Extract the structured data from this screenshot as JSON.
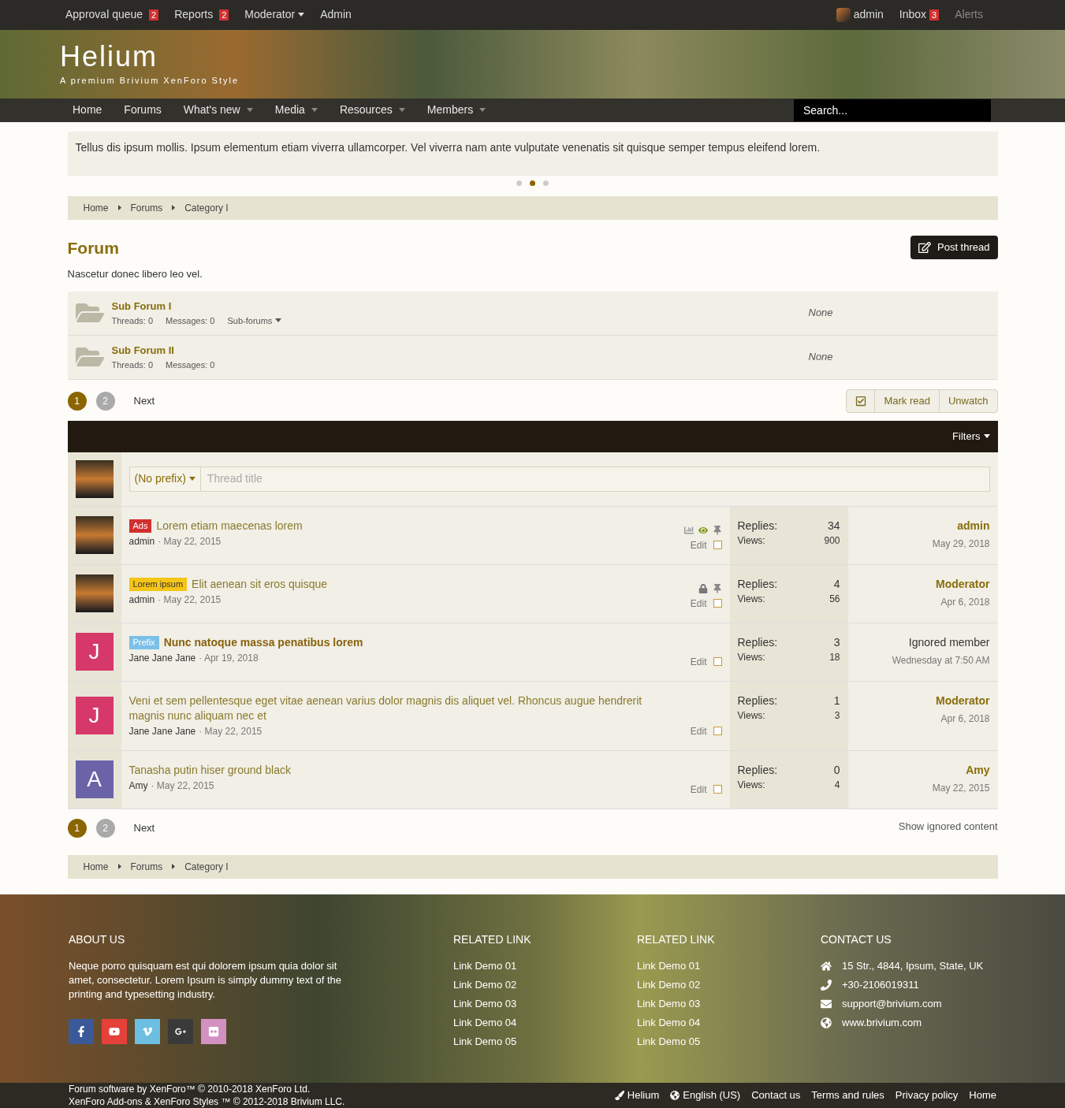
{
  "topbar": {
    "left": [
      {
        "label": "Approval queue",
        "badge": "2",
        "dropdown": false
      },
      {
        "label": "Reports",
        "badge": "2",
        "dropdown": false
      },
      {
        "label": "Moderator",
        "dropdown": true
      },
      {
        "label": "Admin",
        "dropdown": false
      }
    ],
    "user": "admin",
    "inbox": {
      "label": "Inbox",
      "badge": "3"
    },
    "alerts": "Alerts"
  },
  "header": {
    "title": "Helium",
    "tagline": "A premium Brivium XenForo Style"
  },
  "nav": {
    "items": [
      {
        "label": "Home",
        "dropdown": false
      },
      {
        "label": "Forums",
        "dropdown": false
      },
      {
        "label": "What's new",
        "dropdown": true
      },
      {
        "label": "Media",
        "dropdown": true
      },
      {
        "label": "Resources",
        "dropdown": true
      },
      {
        "label": "Members",
        "dropdown": true
      }
    ],
    "search_placeholder": "Search..."
  },
  "notice": {
    "text": "Tellus dis ipsum mollis. Ipsum elementum etiam viverra ullamcorper. Vel viverra nam ante vulputate venenatis sit quisque semper tempus eleifend lorem.",
    "dots": [
      {
        "selected": false
      },
      {
        "selected": true
      },
      {
        "selected": false
      }
    ]
  },
  "breadcrumb_top": [
    "Home",
    "Forums",
    "Category I"
  ],
  "forum": {
    "title": "Forum",
    "description": "Nascetur donec libero leo vel.",
    "post_button": "Post thread"
  },
  "subforums": [
    {
      "title": "Sub Forum I",
      "threads": "Threads: 0",
      "messages": "Messages: 0",
      "menu": "Sub-forums",
      "last": "None"
    },
    {
      "title": "Sub Forum II",
      "threads": "Threads: 0",
      "messages": "Messages: 0",
      "last": "None"
    }
  ],
  "pagination_top": {
    "pages": [
      {
        "label": "1",
        "selected": true
      },
      {
        "label": "2",
        "selected": false
      }
    ],
    "next": "Next"
  },
  "actions": [
    "Mark read",
    "Unwatch"
  ],
  "filters": "Filters",
  "new_thread": {
    "prefix": "(No prefix)",
    "placeholder": "Thread title"
  },
  "threads": [
    {
      "avatar": {
        "kind": "photo"
      },
      "prefix": {
        "label": "Ads",
        "color": "#d32f2f"
      },
      "title": "Lorem etiam maecenas lorem",
      "bold": false,
      "author": "admin",
      "date": "· May 22, 2015",
      "icons": [
        {
          "kind": "stats"
        },
        {
          "kind": "watched"
        },
        {
          "kind": "sticky"
        }
      ],
      "edit": "Edit",
      "checked": false,
      "replies_label": "Replies:",
      "replies": "34",
      "views_label": "Views:",
      "views": "900",
      "last_user": "admin",
      "last_highlight": true,
      "last_date": "May 29, 2018"
    },
    {
      "avatar": {
        "kind": "photo"
      },
      "prefix": {
        "label": "Lorem ipsum",
        "color": "#f5c518"
      },
      "title": "Elit aenean sit eros quisque",
      "bold": false,
      "author": "admin",
      "date": "· May 22, 2015",
      "icons": [
        {
          "kind": "locked"
        },
        {
          "kind": "sticky"
        }
      ],
      "edit": "Edit",
      "checked": false,
      "replies_label": "Replies:",
      "replies": "4",
      "views_label": "Views:",
      "views": "56",
      "last_user": "Moderator",
      "last_highlight": true,
      "last_date": "Apr 6, 2018"
    },
    {
      "avatar": {
        "kind": "letter",
        "letter": "J",
        "color": "#d6386a"
      },
      "prefix": {
        "label": "Prefix",
        "color": "#7cc0e8"
      },
      "title": "Nunc natoque massa penatibus lorem",
      "bold": true,
      "author": "Jane Jane Jane",
      "date": "· Apr 19, 2018",
      "edit": "Edit",
      "checked": false,
      "replies_label": "Replies:",
      "replies": "3",
      "views_label": "Views:",
      "views": "18",
      "last_user": "Ignored member",
      "last_highlight": false,
      "last_date": "Wednesday at 7:50 AM"
    },
    {
      "avatar": {
        "kind": "letter",
        "letter": "J",
        "color": "#d6386a"
      },
      "title": "Veni et sem pellentesque eget vitae aenean varius dolor magnis dis aliquet vel. Rhoncus augue hendrerit magnis nunc aliquam nec et",
      "bold": false,
      "author": "Jane Jane Jane",
      "date": "· May 22, 2015",
      "edit": "Edit",
      "checked": false,
      "replies_label": "Replies:",
      "replies": "1",
      "views_label": "Views:",
      "views": "3",
      "last_user": "Moderator",
      "last_highlight": true,
      "last_date": "Apr 6, 2018"
    },
    {
      "avatar": {
        "kind": "letter",
        "letter": "A",
        "color": "#6b63a8"
      },
      "title": "Tanasha putin hiser ground black",
      "bold": false,
      "author": "Amy",
      "date": "· May 22, 2015",
      "edit": "Edit",
      "checked": false,
      "replies_label": "Replies:",
      "replies": "0",
      "views_label": "Views:",
      "views": "4",
      "last_user": "Amy",
      "last_highlight": true,
      "last_date": "May 22, 2015"
    }
  ],
  "pagination_bottom": {
    "pages": [
      {
        "label": "1",
        "selected": true
      },
      {
        "label": "2",
        "selected": false
      }
    ],
    "next": "Next"
  },
  "show_ignored": "Show ignored content",
  "breadcrumb_bottom": [
    "Home",
    "Forums",
    "Category I"
  ],
  "footer": {
    "about": {
      "heading": "ABOUT US",
      "text": "Neque porro quisquam est qui dolorem ipsum quia dolor sit amet, consectetur. Lorem Ipsum is simply dummy text of the printing and typesetting industry."
    },
    "socials": [
      {
        "kind": "facebook",
        "color": "#3b5998"
      },
      {
        "kind": "youtube",
        "color": "#e5413a"
      },
      {
        "kind": "vimeo",
        "color": "#6cbfe0"
      },
      {
        "kind": "googleplus",
        "color": "#3a3a3a"
      },
      {
        "kind": "flickr",
        "color": "#d291c2"
      }
    ],
    "related": [
      {
        "heading": "RELATED LINK",
        "links": [
          "Link Demo 01",
          "Link Demo 02",
          "Link Demo 03",
          "Link Demo 04",
          "Link Demo 05"
        ]
      },
      {
        "heading": "RELATED LINK",
        "links": [
          "Link Demo 01",
          "Link Demo 02",
          "Link Demo 03",
          "Link Demo 04",
          "Link Demo 05"
        ]
      }
    ],
    "contact": {
      "heading": "CONTACT US",
      "items": [
        {
          "kind": "address",
          "text": "15 Str., 4844, Ipsum, State, UK"
        },
        {
          "kind": "phone",
          "text": "+30-2106019311"
        },
        {
          "kind": "email",
          "text": "support@brivium.com"
        },
        {
          "kind": "web",
          "text": "www.brivium.com"
        }
      ]
    }
  },
  "bottom": {
    "copyright": [
      "Forum software by XenForo™ © 2010-2018 XenForo Ltd.",
      "XenForo Add-ons & XenForo Styles ™ © 2012-2018 Brivium LLC."
    ],
    "links": [
      {
        "kind": "style",
        "label": "Helium"
      },
      {
        "kind": "language",
        "label": "English (US)"
      },
      {
        "kind": "plain",
        "label": "Contact us"
      },
      {
        "kind": "plain",
        "label": "Terms and rules"
      },
      {
        "kind": "plain",
        "label": "Privacy policy"
      },
      {
        "kind": "plain",
        "label": "Home"
      }
    ]
  }
}
